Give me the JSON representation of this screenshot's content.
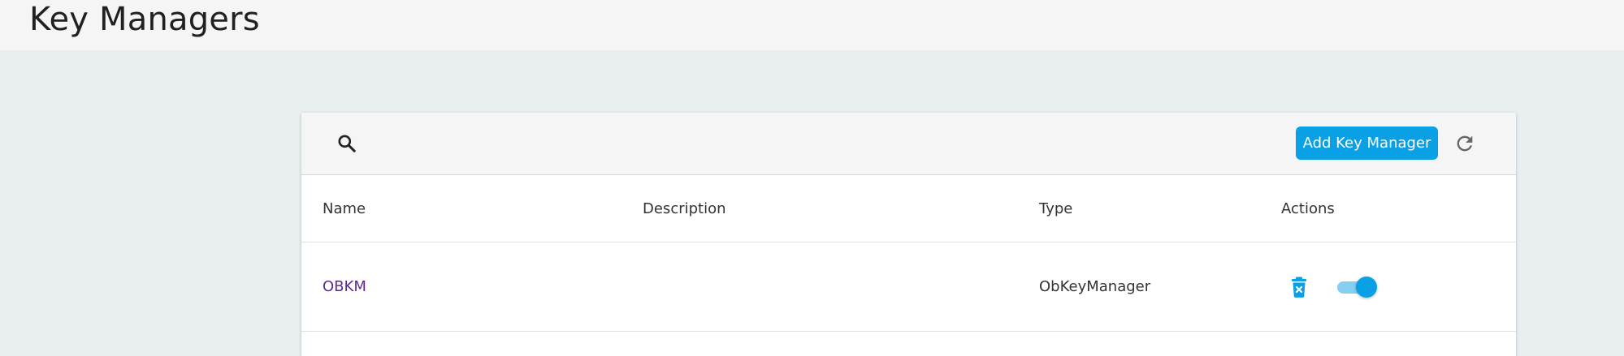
{
  "header": {
    "title": "Key Managers"
  },
  "toolbar": {
    "search_icon": "search-icon",
    "add_label": "Add Key Manager",
    "refresh_icon": "refresh-icon"
  },
  "table": {
    "columns": [
      "Name",
      "Description",
      "Type",
      "Actions"
    ],
    "rows": [
      {
        "name": "OBKM",
        "description": "",
        "type": "ObKeyManager",
        "enabled": true
      }
    ]
  },
  "colors": {
    "accent": "#0aa0e6",
    "link": "#5b2c8e",
    "background": "#e9eef1",
    "header": "#f5f5f5"
  }
}
